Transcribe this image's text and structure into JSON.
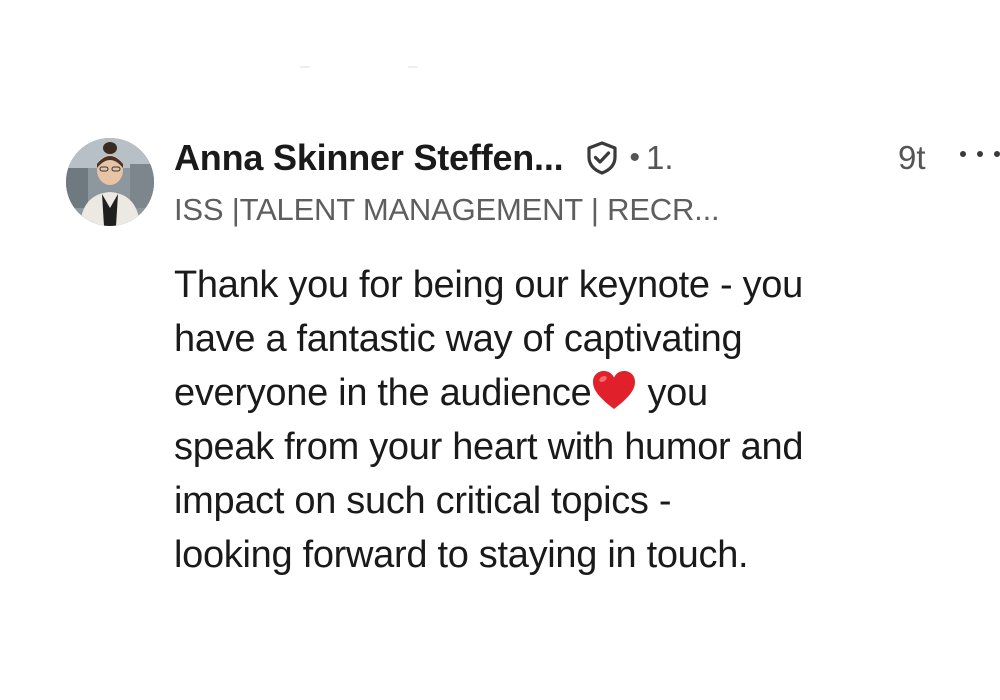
{
  "comment": {
    "author_name": "Anna Skinner Steffen...",
    "verified_icon": "shield-check-icon",
    "separator": "•",
    "connection_degree": "1.",
    "timestamp": "9t",
    "more_icon": "ellipsis-icon",
    "headline": "ISS |TALENT MANAGEMENT | RECR...",
    "body_lines": [
      "Thank you for being our keynote - you",
      "have a fantastic way of captivating",
      "everyone in the audience",
      "you",
      "speak from your heart with humor and",
      "impact on such critical topics -",
      "looking forward to staying in touch."
    ],
    "heart_icon": "red-heart-emoji-icon"
  },
  "colors": {
    "text_primary": "#1a1a1a",
    "text_secondary": "#5e5e5e",
    "heart": "#e0202a",
    "background": "#ffffff"
  }
}
